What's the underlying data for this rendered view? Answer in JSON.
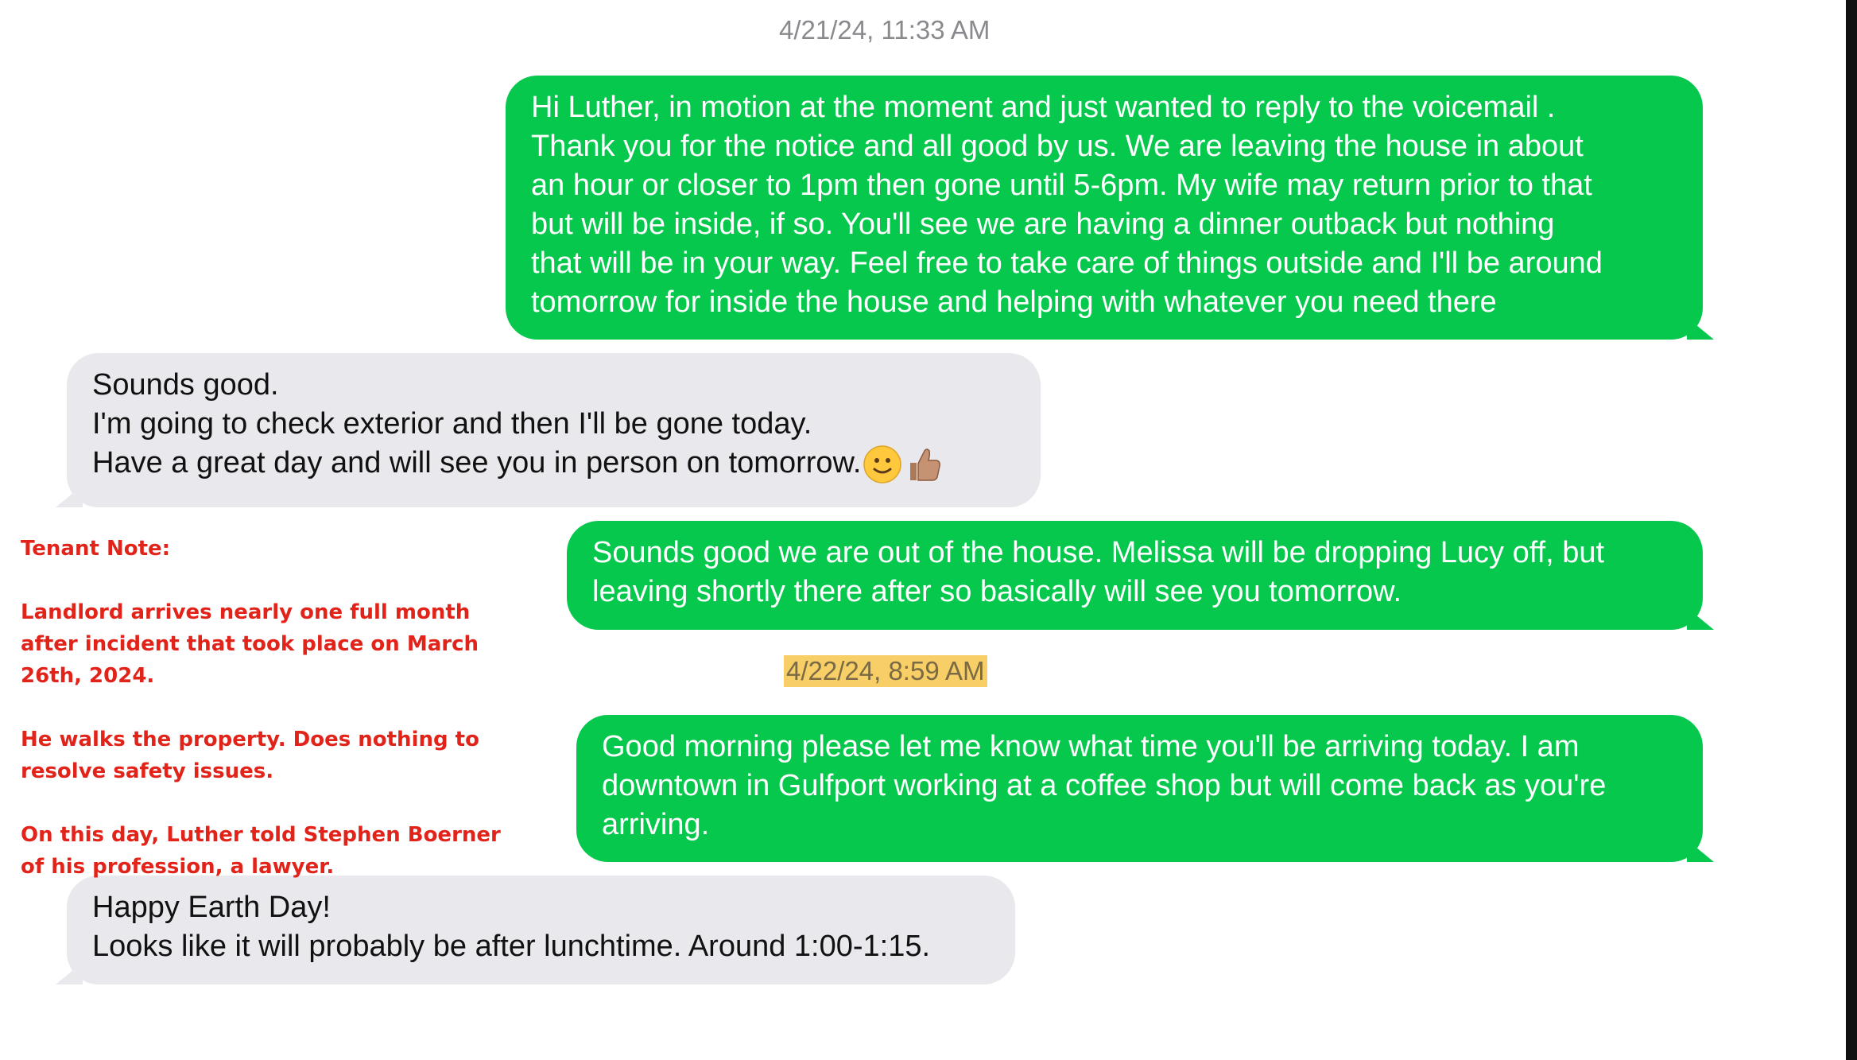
{
  "conversation": {
    "timestamps": [
      "4/21/24, 11:33 AM",
      "4/22/24, 8:59 AM"
    ],
    "messages": [
      {
        "sender": "me",
        "lines": [
          "Hi Luther, in motion at the moment and just wanted to reply to the voicemail .",
          "Thank you for the notice and all good by us. We are leaving the house in about",
          "an hour or closer to 1pm then gone until 5-6pm. My wife may return prior to that",
          "but will be inside, if so. You'll see we are having a dinner outback but nothing",
          "that will be in your way. Feel free to take care of things outside and I'll be around",
          "tomorrow for inside the house and helping with whatever you need there"
        ]
      },
      {
        "sender": "other",
        "lines": [
          "Sounds good.",
          "I'm going to check exterior and then I'll be gone today.",
          "Have a great day and will see you in person on tomorrow."
        ],
        "emojis": [
          "slightly-smiling-face",
          "thumbs-up-medium-skin-tone"
        ]
      },
      {
        "sender": "me",
        "lines": [
          "Sounds good we are out of the house. Melissa will be dropping Lucy off, but",
          "leaving shortly there after so basically will see you tomorrow."
        ]
      },
      {
        "sender": "me",
        "lines": [
          "Good morning please let me know what time you'll be arriving today. I am",
          "downtown in Gulfport working at a coffee shop but will come back as you're",
          "arriving."
        ]
      },
      {
        "sender": "other",
        "lines": [
          "Happy Earth Day!",
          "Looks like it will probably be after lunchtime. Around 1:00-1:15."
        ]
      }
    ]
  },
  "annotation": {
    "heading": "Tenant Note:",
    "paragraphs": [
      "Landlord arrives nearly one full month after incident that took place on March 26th, 2024.",
      "He walks the property. Does nothing to resolve safety issues.",
      "On this day, Luther told Stephen Boerner of his profession, a lawyer."
    ]
  },
  "colors": {
    "sent_bubble": "#05c84d",
    "received_bubble": "#e8e8ed",
    "note_text": "#e2231a",
    "timestamp_highlight": "#f7cf66"
  }
}
